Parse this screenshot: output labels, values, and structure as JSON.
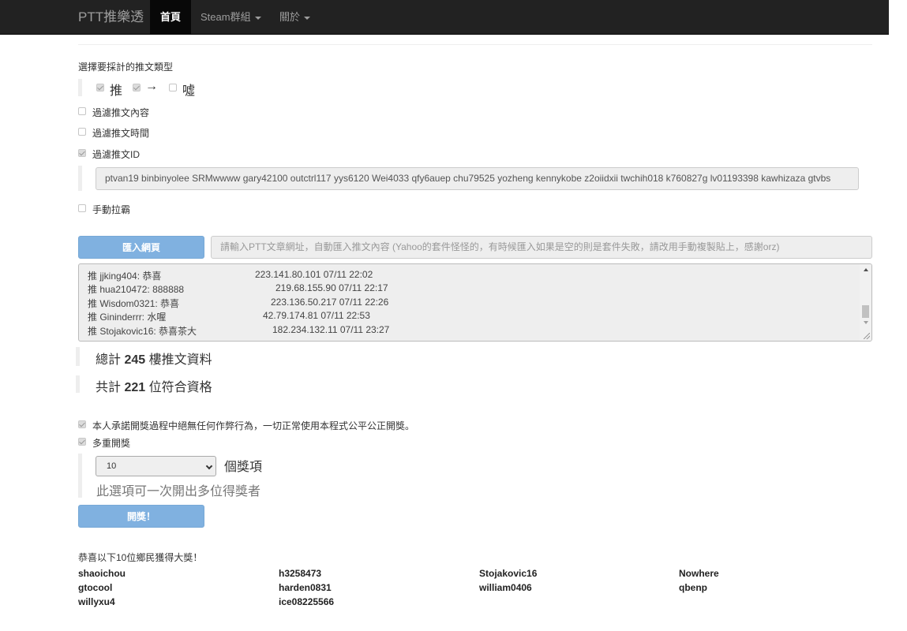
{
  "navbar": {
    "brand": "PTT推樂透",
    "items": [
      {
        "label": "首頁",
        "active": true
      },
      {
        "label": "Steam群組",
        "dropdown": true
      },
      {
        "label": "關於",
        "dropdown": true
      }
    ]
  },
  "push_type": {
    "title": "選擇要採計的推文類型",
    "options": [
      {
        "label": "推",
        "checked": true
      },
      {
        "label": "→",
        "checked": true
      },
      {
        "label": "噓",
        "checked": false
      }
    ]
  },
  "filters": {
    "content": {
      "label": "過濾推文內容",
      "checked": false
    },
    "time": {
      "label": "過濾推文時間",
      "checked": false
    },
    "id": {
      "label": "過濾推文ID",
      "checked": true
    },
    "id_list": "ptvan19 binbinyolee SRMwwww gary42100 outctrl117 yys6120 Wei4033 qfy6auep chu79525 yozheng kennykobe z2oiidxii twchih018 k760827g lv01193398 kawhizaza gtvbs",
    "manual": {
      "label": "手動拉霸",
      "checked": false
    }
  },
  "import": {
    "button": "匯入網頁",
    "placeholder": "請輸入PTT文章網址，自動匯入推文內容 (Yahoo的套件怪怪的，有時候匯入如果是空的則是套件失敗，請改用手動複製貼上，感謝orz)"
  },
  "pushes": [
    {
      "text": "推 jjking404: 恭喜",
      "meta": "223.141.80.101 07/11 22:02"
    },
    {
      "text": "推 hua210472: 888888",
      "meta": "219.68.155.90 07/11 22:17"
    },
    {
      "text": "推 Wisdom0321: 恭喜",
      "meta": "223.136.50.217 07/11 22:26"
    },
    {
      "text": "推 Gininderrr: 水喔",
      "meta": "42.79.174.81 07/11 22:53"
    },
    {
      "text": "推 Stojakovic16: 恭喜茶大",
      "meta": "182.234.132.11 07/11 23:27"
    }
  ],
  "stats": {
    "total_prefix": "總計",
    "total_count": "245",
    "total_suffix": "樓推文資料",
    "eligible_prefix": "共計",
    "eligible_count": "221",
    "eligible_suffix": "位符合資格"
  },
  "draw": {
    "pledge": {
      "label": "本人承諾開獎過程中絕無任何作弊行為，一切正常使用本程式公平公正開獎。",
      "checked": true
    },
    "multi": {
      "label": "多重開獎",
      "checked": true
    },
    "prize_count": "10",
    "prize_unit": "個獎項",
    "help": "此選項可一次開出多位得獎者",
    "button": "開獎！"
  },
  "winners": {
    "title": "恭喜以下10位鄉民獲得大獎！",
    "names": [
      "shaoichou",
      "h3258473",
      "Stojakovic16",
      "Nowhere",
      "gtocool",
      "harden0831",
      "william0406",
      "qbenp",
      "willyxu4",
      "ice08225566"
    ]
  }
}
